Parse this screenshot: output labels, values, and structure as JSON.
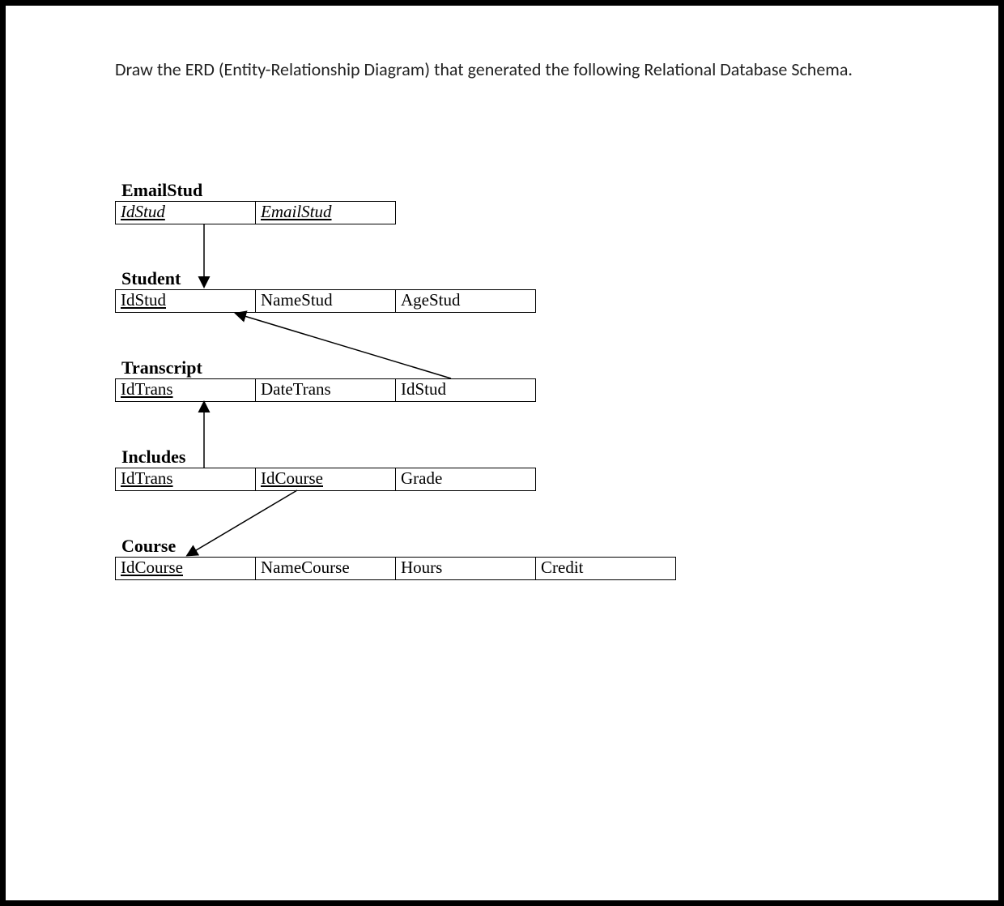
{
  "prompt": "Draw the ERD (Entity-Relationship Diagram) that generated the following Relational Database Schema.",
  "tables": {
    "emailstud": {
      "title": "EmailStud",
      "cols": [
        "IdStud",
        "EmailStud"
      ]
    },
    "student": {
      "title": "Student",
      "cols": [
        "IdStud",
        "NameStud",
        "AgeStud"
      ]
    },
    "transcript": {
      "title": "Transcript",
      "cols": [
        "IdTrans",
        "DateTrans",
        "IdStud"
      ]
    },
    "includes": {
      "title": "Includes",
      "cols": [
        "IdTrans",
        "IdCourse",
        "Grade"
      ]
    },
    "course": {
      "title": "Course",
      "cols": [
        "IdCourse",
        "NameCourse",
        "Hours",
        "Credit"
      ]
    }
  },
  "chart_data": {
    "type": "table",
    "title": "Relational Database Schema",
    "relations": [
      {
        "name": "EmailStud",
        "columns": [
          {
            "name": "IdStud",
            "key": "pk,fk"
          },
          {
            "name": "EmailStud",
            "key": "pk"
          }
        ]
      },
      {
        "name": "Student",
        "columns": [
          {
            "name": "IdStud",
            "key": "pk"
          },
          {
            "name": "NameStud"
          },
          {
            "name": "AgeStud"
          }
        ]
      },
      {
        "name": "Transcript",
        "columns": [
          {
            "name": "IdTrans",
            "key": "pk"
          },
          {
            "name": "DateTrans"
          },
          {
            "name": "IdStud",
            "key": "fk"
          }
        ]
      },
      {
        "name": "Includes",
        "columns": [
          {
            "name": "IdTrans",
            "key": "pk,fk"
          },
          {
            "name": "IdCourse",
            "key": "pk,fk"
          },
          {
            "name": "Grade"
          }
        ]
      },
      {
        "name": "Course",
        "columns": [
          {
            "name": "IdCourse",
            "key": "pk"
          },
          {
            "name": "NameCourse"
          },
          {
            "name": "Hours"
          },
          {
            "name": "Credit"
          }
        ]
      }
    ],
    "fk_arrows": [
      {
        "from": "EmailStud.IdStud",
        "to": "Student.IdStud"
      },
      {
        "from": "Transcript.IdStud",
        "to": "Student.IdStud"
      },
      {
        "from": "Includes.IdTrans",
        "to": "Transcript.IdTrans"
      },
      {
        "from": "Includes.IdCourse",
        "to": "Course.IdCourse"
      }
    ]
  }
}
